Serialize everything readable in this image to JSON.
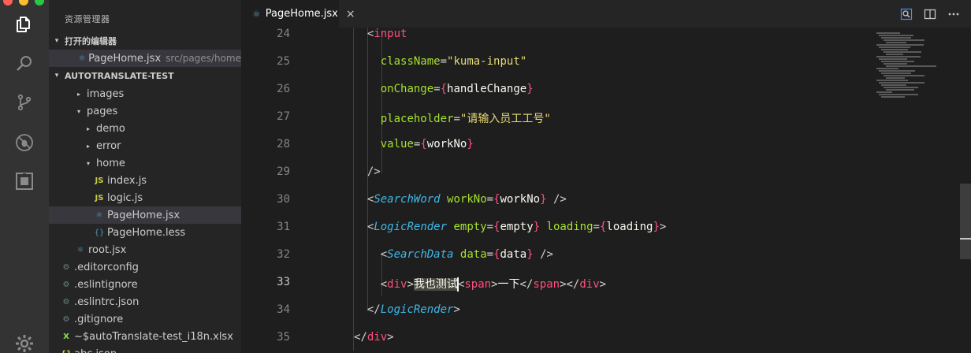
{
  "window": {
    "colors": {
      "close": "#ff5f57",
      "minimize": "#febc2e",
      "zoom": "#28c840"
    }
  },
  "activity_bar": {
    "icons": [
      "explorer-icon",
      "search-icon",
      "source-control-icon",
      "debug-icon",
      "extensions-icon",
      "settings-gear-icon"
    ]
  },
  "sidebar": {
    "title": "资源管理器",
    "open_editors": {
      "header": "打开的编辑器",
      "items": [
        {
          "name": "PageHome.jsx",
          "path": "src/pages/home"
        }
      ]
    },
    "workspace": {
      "header": "AUTOTRANSLATE-TEST",
      "tree": [
        {
          "label": "images",
          "kind": "folder-collapsed"
        },
        {
          "label": "pages",
          "kind": "folder-open"
        },
        {
          "label": "demo",
          "kind": "folder-collapsed"
        },
        {
          "label": "error",
          "kind": "folder-collapsed"
        },
        {
          "label": "home",
          "kind": "folder-open"
        },
        {
          "label": "index.js",
          "kind": "js"
        },
        {
          "label": "logic.js",
          "kind": "js"
        },
        {
          "label": "PageHome.jsx",
          "kind": "jsx"
        },
        {
          "label": "PageHome.less",
          "kind": "less"
        },
        {
          "label": "root.jsx",
          "kind": "jsx"
        },
        {
          "label": ".editorconfig",
          "kind": "config"
        },
        {
          "label": ".eslintignore",
          "kind": "config"
        },
        {
          "label": ".eslintrc.json",
          "kind": "config"
        },
        {
          "label": ".gitignore",
          "kind": "config"
        },
        {
          "label": "~$autoTranslate-test_i18n.xlsx",
          "kind": "xlsx"
        },
        {
          "label": "abc.json",
          "kind": "json"
        }
      ]
    }
  },
  "editor": {
    "tab": {
      "label": "PageHome.jsx",
      "close": "×"
    },
    "active_line": 33,
    "lines": [
      {
        "n": 24,
        "tokens": [
          [
            "<",
            "p"
          ],
          [
            "input",
            "tag"
          ]
        ]
      },
      {
        "n": 25,
        "tokens": [
          [
            "className",
            "attr"
          ],
          [
            "=",
            "p"
          ],
          [
            "\"kuma-input\"",
            "str"
          ]
        ]
      },
      {
        "n": 26,
        "tokens": [
          [
            "onChange",
            "attr"
          ],
          [
            "=",
            "p"
          ],
          [
            "{",
            "brace"
          ],
          [
            "handleChange",
            "expr"
          ],
          [
            "}",
            "brace"
          ]
        ]
      },
      {
        "n": 27,
        "tokens": [
          [
            "placeholder",
            "attr"
          ],
          [
            "=",
            "p"
          ],
          [
            "\"请输入员工工号\"",
            "str"
          ]
        ]
      },
      {
        "n": 28,
        "tokens": [
          [
            "value",
            "attr"
          ],
          [
            "=",
            "p"
          ],
          [
            "{",
            "brace"
          ],
          [
            "workNo",
            "expr"
          ],
          [
            "}",
            "brace"
          ]
        ]
      },
      {
        "n": 29,
        "tokens": [
          [
            "/>",
            "p"
          ]
        ]
      },
      {
        "n": 30,
        "tokens": [
          [
            "<",
            "p"
          ],
          [
            "SearchWord",
            "comp"
          ],
          [
            " ",
            "p"
          ],
          [
            "workNo",
            "attr"
          ],
          [
            "=",
            "p"
          ],
          [
            "{",
            "brace"
          ],
          [
            "workNo",
            "expr"
          ],
          [
            "}",
            "brace"
          ],
          [
            " />",
            "p"
          ]
        ]
      },
      {
        "n": 31,
        "tokens": [
          [
            "<",
            "p"
          ],
          [
            "LogicRender",
            "comp"
          ],
          [
            " ",
            "p"
          ],
          [
            "empty",
            "attr"
          ],
          [
            "=",
            "p"
          ],
          [
            "{",
            "brace"
          ],
          [
            "empty",
            "expr"
          ],
          [
            "}",
            "brace"
          ],
          [
            " ",
            "p"
          ],
          [
            "loading",
            "attr"
          ],
          [
            "=",
            "p"
          ],
          [
            "{",
            "brace"
          ],
          [
            "loading",
            "expr"
          ],
          [
            "}",
            "brace"
          ],
          [
            ">",
            "p"
          ]
        ]
      },
      {
        "n": 32,
        "tokens": [
          [
            "<",
            "p"
          ],
          [
            "SearchData",
            "comp"
          ],
          [
            " ",
            "p"
          ],
          [
            "data",
            "attr"
          ],
          [
            "=",
            "p"
          ],
          [
            "{",
            "brace"
          ],
          [
            "data",
            "expr"
          ],
          [
            "}",
            "brace"
          ],
          [
            " />",
            "p"
          ]
        ]
      },
      {
        "n": 33,
        "tokens": [
          [
            "<",
            "p"
          ],
          [
            "div",
            "tag"
          ],
          [
            ">",
            "p"
          ],
          [
            "我也测试",
            "sel"
          ],
          [
            "|",
            "cursor"
          ],
          [
            "<",
            "p"
          ],
          [
            "span",
            "tag"
          ],
          [
            ">",
            "p"
          ],
          [
            "一下",
            "text"
          ],
          [
            "</",
            "p"
          ],
          [
            "span",
            "tag"
          ],
          [
            "></",
            "p"
          ],
          [
            "div",
            "tag"
          ],
          [
            ">",
            "p"
          ]
        ]
      },
      {
        "n": 34,
        "tokens": [
          [
            "</",
            "p"
          ],
          [
            "LogicRender",
            "comp"
          ],
          [
            ">",
            "p"
          ]
        ]
      },
      {
        "n": 35,
        "tokens": [
          [
            "</",
            "p"
          ],
          [
            "div",
            "tag"
          ],
          [
            ">",
            "p"
          ]
        ]
      }
    ]
  }
}
